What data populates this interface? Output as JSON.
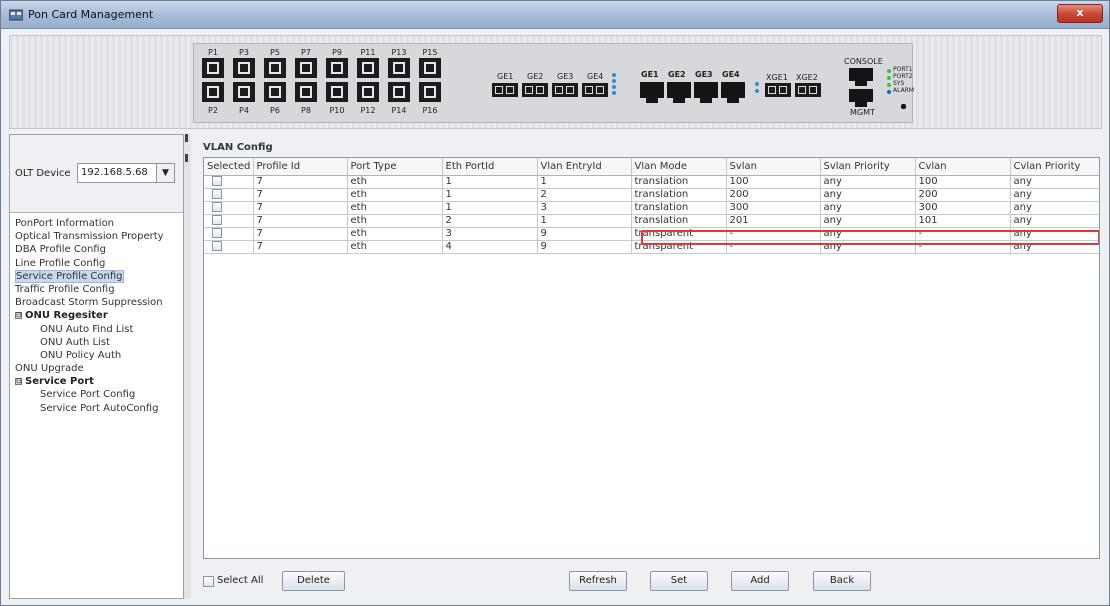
{
  "window": {
    "title": "Pon Card Management",
    "close_label": "x"
  },
  "device": {
    "pon_top": [
      "P1",
      "P3",
      "P5",
      "P7",
      "P9",
      "P11",
      "P13",
      "P15"
    ],
    "pon_bottom": [
      "P2",
      "P4",
      "P6",
      "P8",
      "P10",
      "P12",
      "P14",
      "P16"
    ],
    "ge_sfp": [
      "GE1",
      "GE2",
      "GE3",
      "GE4"
    ],
    "ge_rj": [
      "GE1",
      "GE2",
      "GE3",
      "GE4"
    ],
    "xge": [
      "XGE1",
      "XGE2"
    ],
    "console": "CONSOLE",
    "mgmt": "MGMT",
    "leds": [
      "PORT1",
      "PORT2",
      "SYS",
      "ALARM"
    ],
    "rst": "RST"
  },
  "left": {
    "olt_label": "OLT Device",
    "olt_value": "192.168.5.68",
    "tree": [
      {
        "label": "PonPort Information",
        "level": 0
      },
      {
        "label": "Optical Transmission Property",
        "level": 0
      },
      {
        "label": "DBA Profile Config",
        "level": 0
      },
      {
        "label": "Line Profile Config",
        "level": 0
      },
      {
        "label": "Service Profile Config",
        "level": 0,
        "selected": true
      },
      {
        "label": "Traffic Profile Config",
        "level": 0
      },
      {
        "label": "Broadcast Storm Suppression",
        "level": 0
      },
      {
        "label": "ONU Regesiter",
        "level": 0,
        "group": true,
        "expander": "⊟"
      },
      {
        "label": "ONU Auto Find List",
        "level": 1
      },
      {
        "label": "ONU Auth List",
        "level": 1
      },
      {
        "label": "ONU Policy Auth",
        "level": 1
      },
      {
        "label": "ONU Upgrade",
        "level": 0
      },
      {
        "label": "Service Port",
        "level": 0,
        "group": true,
        "expander": "⊟"
      },
      {
        "label": "Service Port Config",
        "level": 1
      },
      {
        "label": "Service Port AutoConfig",
        "level": 1
      }
    ]
  },
  "main": {
    "section_title": "VLAN Config",
    "columns": [
      "Selected",
      "Profile Id",
      "Port Type",
      "Eth PortId",
      "Vlan EntryId",
      "Vlan Mode",
      "Svlan",
      "Svlan Priority",
      "Cvlan",
      "Cvlan Priority"
    ],
    "rows": [
      [
        "",
        "7",
        "eth",
        "1",
        "1",
        "translation",
        "100",
        "any",
        "100",
        "any"
      ],
      [
        "",
        "7",
        "eth",
        "1",
        "2",
        "translation",
        "200",
        "any",
        "200",
        "any"
      ],
      [
        "",
        "7",
        "eth",
        "1",
        "3",
        "translation",
        "300",
        "any",
        "300",
        "any"
      ],
      [
        "",
        "7",
        "eth",
        "2",
        "1",
        "translation",
        "201",
        "any",
        "101",
        "any"
      ],
      [
        "",
        "7",
        "eth",
        "3",
        "9",
        "transparent",
        "-",
        "any",
        "-",
        "any"
      ],
      [
        "",
        "7",
        "eth",
        "4",
        "9",
        "transparent",
        "-",
        "any",
        "-",
        "any"
      ]
    ],
    "highlight_color": "#d93a3a",
    "select_all_label": "Select All",
    "buttons": {
      "delete": "Delete",
      "refresh": "Refresh",
      "set": "Set",
      "add": "Add",
      "back": "Back"
    }
  }
}
